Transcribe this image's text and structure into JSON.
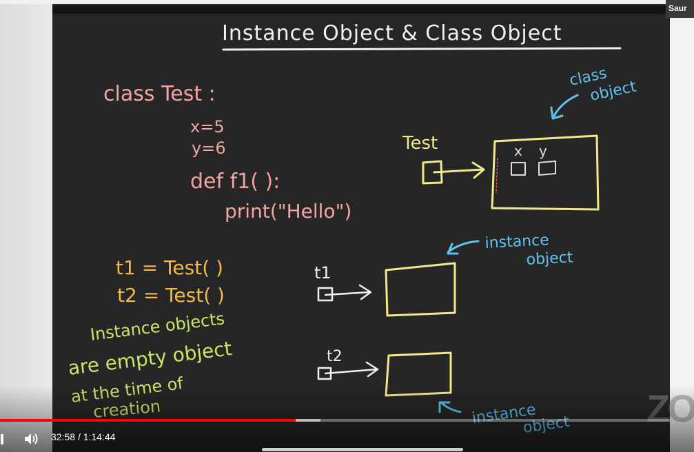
{
  "header": {
    "user_name": "Saur"
  },
  "lecture": {
    "title": "Instance Object & Class Object",
    "code_line1": "class Test :",
    "code_line2": "x=5",
    "code_line3": "y=6",
    "code_line4": "def f1( ):",
    "code_line5": "print(\"Hello\")",
    "assign1": "t1 = Test( )",
    "assign2": "t2 = Test( )",
    "note_line1": "Instance objects",
    "note_line2": "are empty object",
    "note_line3": "at the time of",
    "note_line4": "creation",
    "class_ref_label": "Test",
    "attr_x": "x",
    "attr_y": "y",
    "class_object_label1": "class",
    "class_object_label2": "object",
    "t1_label": "t1",
    "t2_label": "t2",
    "instance_label_a1": "instance",
    "instance_label_a2": "object",
    "instance_label_b1": "instance",
    "instance_label_b2": "object"
  },
  "watermark": "ZO",
  "player": {
    "current_time": "32:58",
    "separator": "/",
    "duration": "1:14:44",
    "progress_fraction": 0.4414,
    "buffer_fraction": 0.4783
  },
  "colors": {
    "board": "#262626",
    "pink": "#f4a3a3",
    "yellow": "#f2e98a",
    "orange": "#f6b84d",
    "green": "#c8e667",
    "blue": "#5fc3f0",
    "white": "#f1f1f1",
    "progress": "#ff0000"
  }
}
